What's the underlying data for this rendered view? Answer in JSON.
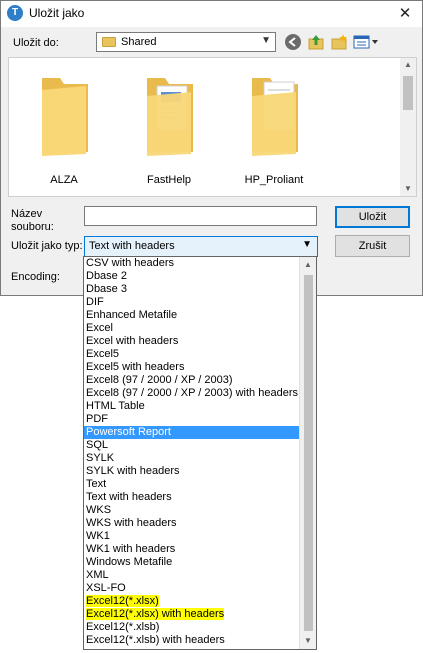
{
  "window": {
    "title": "Uložit jako",
    "close_glyph": "✕"
  },
  "location": {
    "label": "Uložit do:",
    "value": "Shared"
  },
  "folders": [
    {
      "name": "ALZA"
    },
    {
      "name": "FastHelp"
    },
    {
      "name": "HP_Proliant"
    }
  ],
  "filename": {
    "label_line1": "Název",
    "label_line2": "souboru:",
    "value": ""
  },
  "filetype": {
    "label": "Uložit jako typ:",
    "value": "Text with headers"
  },
  "encoding": {
    "label": "Encoding:"
  },
  "buttons": {
    "save": "Uložit",
    "cancel": "Zrušit"
  },
  "dropdown": {
    "items": [
      "CSV with headers",
      "Dbase 2",
      "Dbase 3",
      "DIF",
      "Enhanced Metafile",
      "Excel",
      "Excel with headers",
      "Excel5",
      "Excel5 with headers",
      "Excel8 (97 / 2000 / XP / 2003)",
      "Excel8 (97 / 2000 / XP / 2003) with headers",
      "HTML Table",
      "PDF",
      "Powersoft Report",
      "SQL",
      "SYLK",
      "SYLK with headers",
      "Text",
      "Text with headers",
      "WKS",
      "WKS with headers",
      "WK1",
      "WK1 with headers",
      "Windows Metafile",
      "XML",
      "XSL-FO",
      "Excel12(*.xlsx)",
      "Excel12(*.xlsx) with headers",
      "Excel12(*.xlsb)",
      "Excel12(*.xlsb) with headers"
    ],
    "selected_index": 13,
    "highlighted_indices": [
      26,
      27
    ]
  },
  "colors": {
    "accent": "#0078d7",
    "selection": "#3399ff",
    "highlight": "#ffff00",
    "folder": "#f7d774"
  }
}
